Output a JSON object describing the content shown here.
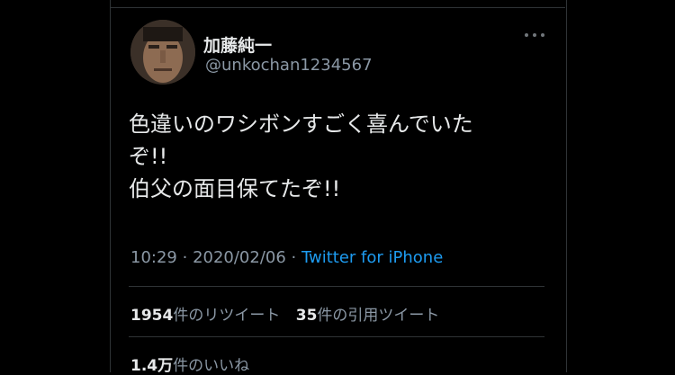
{
  "tweet": {
    "author": {
      "display_name": "加藤純一",
      "handle": "@unkochan1234567"
    },
    "text_lines": [
      "色違いのワシボンすごく喜んでいた",
      "ぞ!!",
      "伯父の面目保てたぞ!!"
    ],
    "time": "10:29",
    "date": "2020/02/06",
    "separator": "·",
    "source": "Twitter for iPhone",
    "retweets": {
      "count": "1954",
      "label": "件のリツイート"
    },
    "quotes": {
      "count": "35",
      "label": "件の引用ツイート"
    },
    "likes": {
      "count": "1.4万",
      "label": "件のいいね"
    }
  },
  "colors": {
    "background": "#000000",
    "text": "#e7e9ea",
    "secondary": "#8b98a5",
    "link": "#1d9bf0",
    "divider": "#2f3336"
  },
  "icons": {
    "more": "more-horizontal-icon"
  }
}
